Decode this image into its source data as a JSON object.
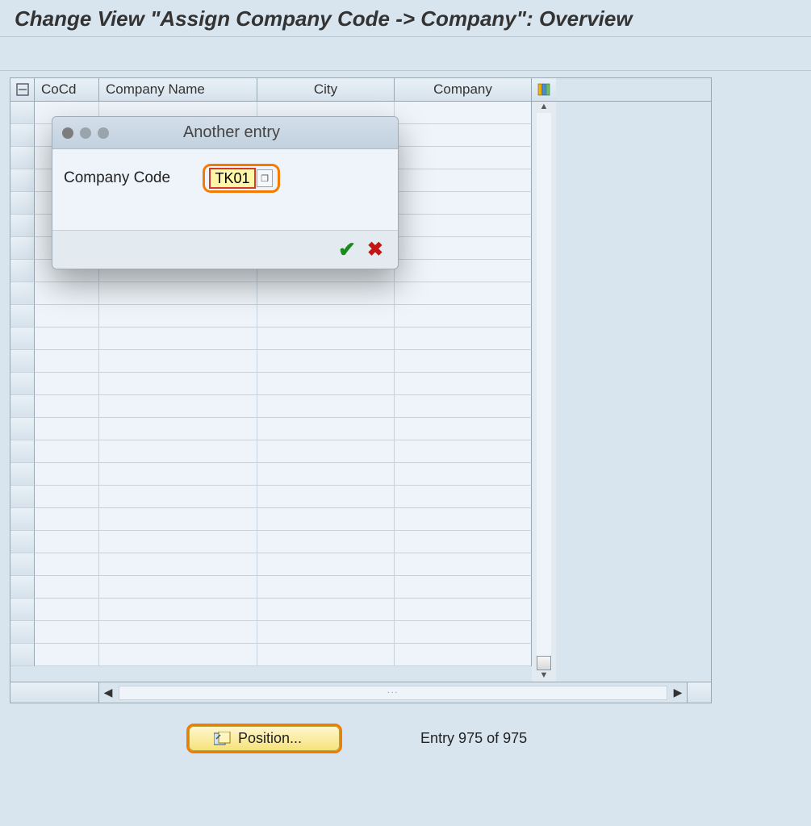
{
  "page": {
    "title": "Change View \"Assign Company Code -> Company\": Overview"
  },
  "table": {
    "columns": {
      "cocd": "CoCd",
      "company_name": "Company Name",
      "city": "City",
      "company": "Company"
    },
    "row_count": 25
  },
  "footer": {
    "position_label": "Position...",
    "entry_text": "Entry 975 of 975"
  },
  "dialog": {
    "title": "Another entry",
    "field_label": "Company Code",
    "field_value": "TK01"
  }
}
